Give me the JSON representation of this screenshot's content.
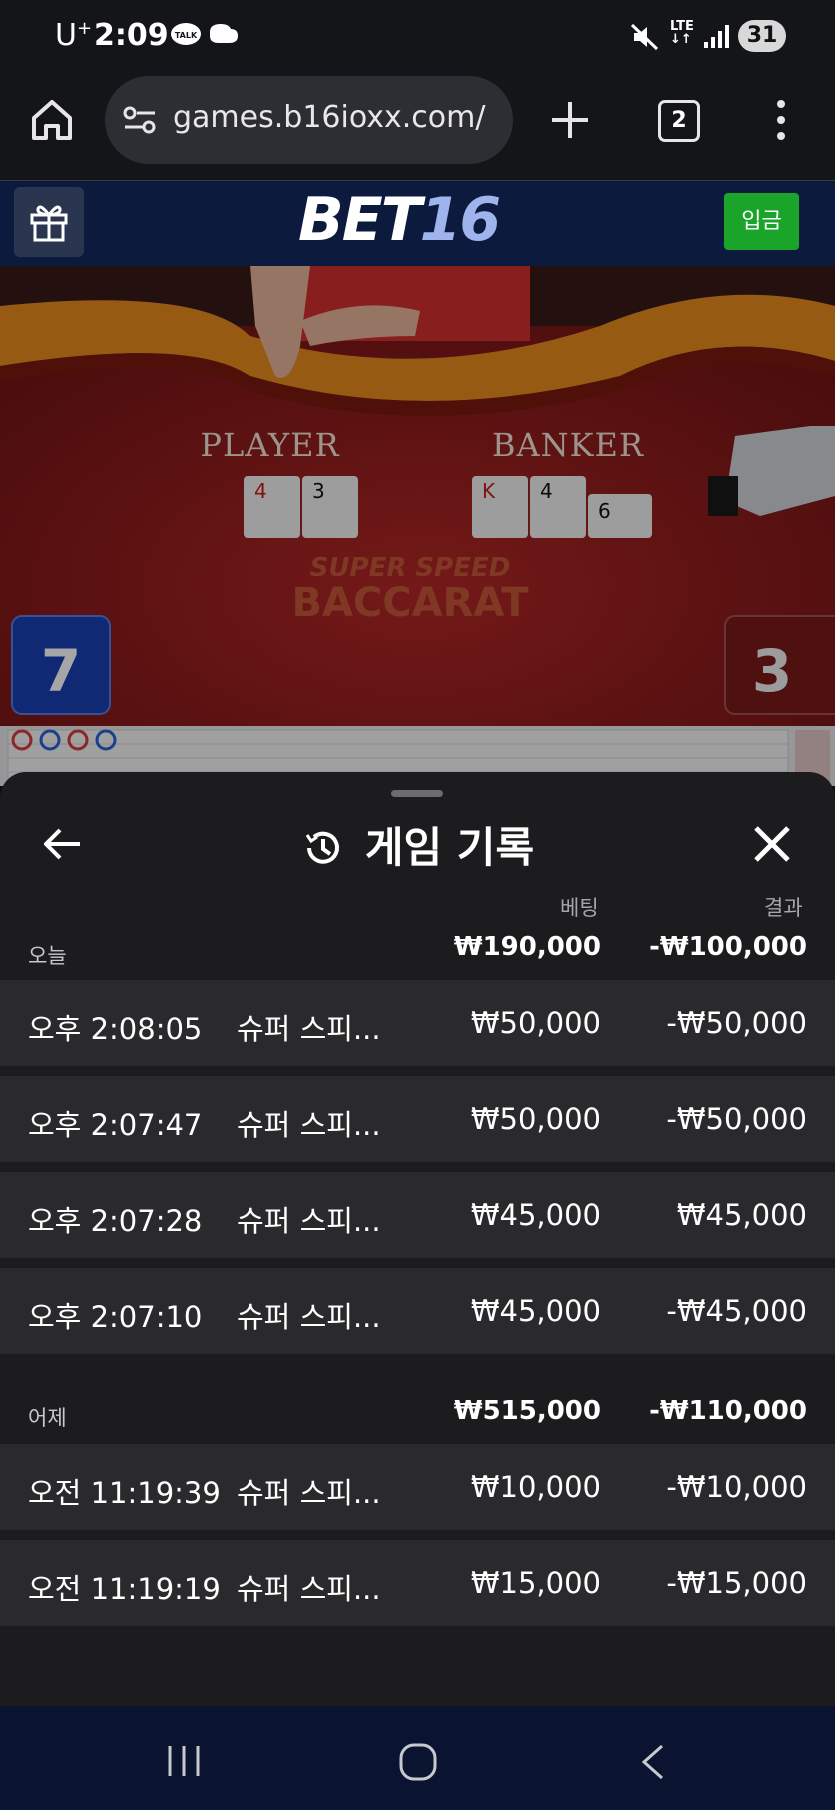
{
  "status_bar": {
    "carrier": "U",
    "carrier_sup": "+",
    "time": "2:09",
    "network": "LTE",
    "battery": "31"
  },
  "browser": {
    "url": "games.b16ioxx.com/",
    "tab_count": "2"
  },
  "site_header": {
    "logo_part1": "BET",
    "logo_part2": "16",
    "deposit_label": "입금",
    "colors": {
      "header_bg": "#0c1a3d",
      "deposit_bg": "#1aa52a",
      "logo_accent": "#9fb4ec"
    }
  },
  "game": {
    "player_label": "PLAYER",
    "banker_label": "BANKER",
    "title_line1": "SUPER SPEED",
    "title_line2": "BACCARAT",
    "player_score": "7",
    "banker_score": "3",
    "player_cards": [
      "4",
      "3"
    ],
    "banker_cards": [
      "K",
      "4",
      "6"
    ]
  },
  "history_sheet": {
    "title": "게임 기록",
    "col_bet": "베팅",
    "col_result": "결과",
    "sections": [
      {
        "label": "오늘",
        "total_bet": "₩190,000",
        "total_result": "-₩100,000",
        "rows": [
          {
            "time": "오후 2:08:05",
            "game": "슈퍼 스피...",
            "bet": "₩50,000",
            "result": "-₩50,000"
          },
          {
            "time": "오후 2:07:47",
            "game": "슈퍼 스피...",
            "bet": "₩50,000",
            "result": "-₩50,000"
          },
          {
            "time": "오후 2:07:28",
            "game": "슈퍼 스피...",
            "bet": "₩45,000",
            "result": "₩45,000"
          },
          {
            "time": "오후 2:07:10",
            "game": "슈퍼 스피...",
            "bet": "₩45,000",
            "result": "-₩45,000"
          }
        ]
      },
      {
        "label": "어제",
        "total_bet": "₩515,000",
        "total_result": "-₩110,000",
        "rows": [
          {
            "time": "오전 11:19:39",
            "game": "슈퍼 스피...",
            "bet": "₩10,000",
            "result": "-₩10,000"
          },
          {
            "time": "오전 11:19:19",
            "game": "슈퍼 스피...",
            "bet": "₩15,000",
            "result": "-₩15,000"
          }
        ]
      }
    ]
  }
}
